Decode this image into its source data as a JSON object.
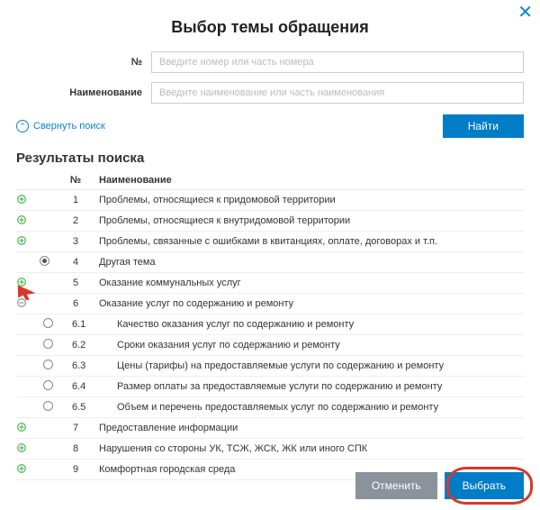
{
  "title": "Выбор темы обращения",
  "form": {
    "num_label": "№",
    "num_placeholder": "Введите номер или часть номера",
    "name_label": "Наименование",
    "name_placeholder": "Введите наименование или часть наименования"
  },
  "collapse_label": "Свернуть поиск",
  "find_label": "Найти",
  "results_title": "Результаты поиска",
  "headers": {
    "num": "№",
    "name": "Наименование"
  },
  "rows": [
    {
      "type": "parent",
      "expand": "plus",
      "radio": false,
      "num": "1",
      "name": "Проблемы, относящиеся к придомовой территории"
    },
    {
      "type": "parent",
      "expand": "plus",
      "radio": false,
      "num": "2",
      "name": "Проблемы, относящиеся к внутридомовой территории"
    },
    {
      "type": "parent",
      "expand": "plus",
      "radio": false,
      "num": "3",
      "name": "Проблемы, связанные с ошибками в квитанциях, оплате, договорах и т.п."
    },
    {
      "type": "parent",
      "expand": "",
      "radio": true,
      "num": "4",
      "name": "Другая тема"
    },
    {
      "type": "parent",
      "expand": "plus",
      "radio": false,
      "num": "5",
      "name": "Оказание коммунальных услуг"
    },
    {
      "type": "parent",
      "expand": "open",
      "radio": false,
      "num": "6",
      "name": "Оказание услуг по содержанию и ремонту"
    },
    {
      "type": "child",
      "radio": false,
      "num": "6.1",
      "name": "Качество оказания услуг по содержанию и ремонту"
    },
    {
      "type": "child",
      "radio": false,
      "num": "6.2",
      "name": "Сроки оказания услуг по содержанию и ремонту"
    },
    {
      "type": "child",
      "radio": false,
      "num": "6.3",
      "name": "Цены (тарифы) на предоставляемые услуги по содержанию и ремонту"
    },
    {
      "type": "child",
      "radio": false,
      "num": "6.4",
      "name": "Размер оплаты за предоставляемые услуги по содержанию и ремонту"
    },
    {
      "type": "child",
      "radio": false,
      "num": "6.5",
      "name": "Объем и перечень предоставляемых услуг по содержанию и ремонту"
    },
    {
      "type": "parent",
      "expand": "plus",
      "radio": false,
      "num": "7",
      "name": "Предоставление информации"
    },
    {
      "type": "parent",
      "expand": "plus",
      "radio": false,
      "num": "8",
      "name": "Нарушения со стороны УК, ТСЖ, ЖСК, ЖК или иного СПК"
    },
    {
      "type": "parent",
      "expand": "plus",
      "radio": false,
      "num": "9",
      "name": "Комфортная городская среда"
    }
  ],
  "footer": {
    "cancel": "Отменить",
    "select": "Выбрать"
  }
}
